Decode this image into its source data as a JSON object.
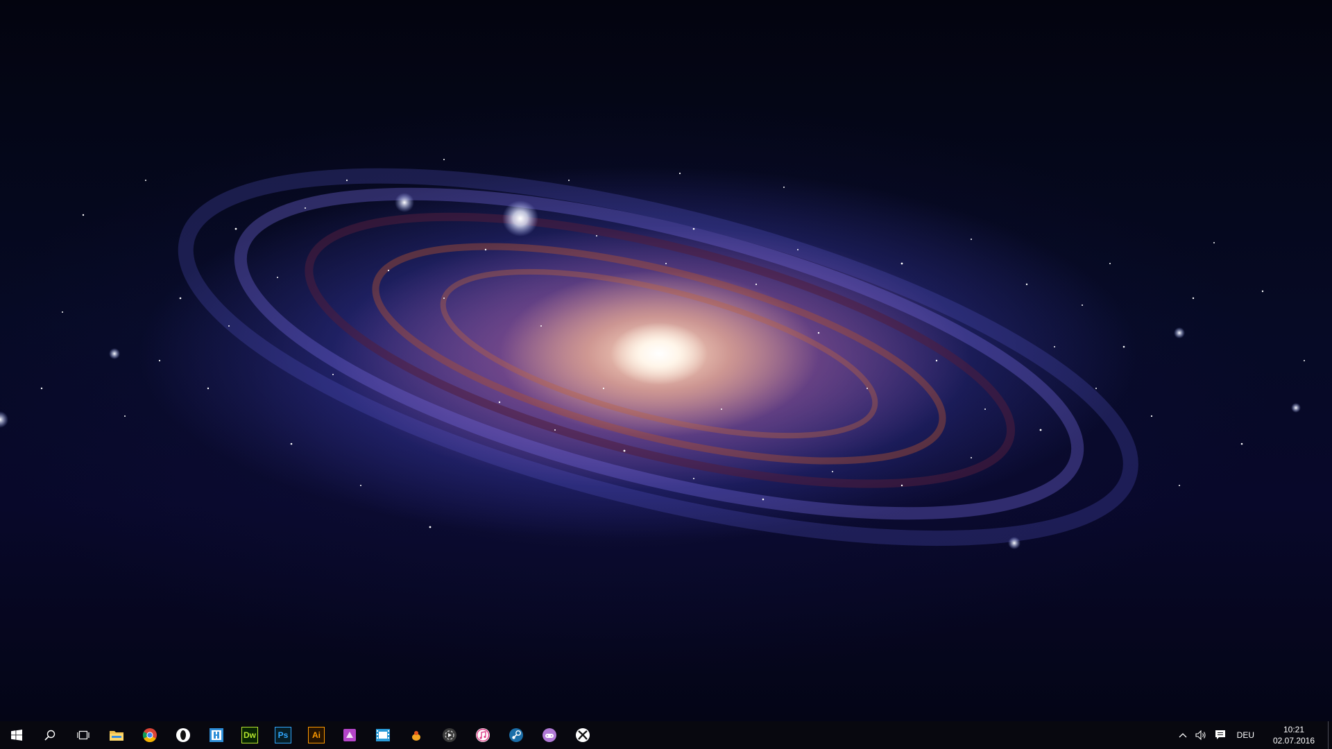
{
  "desktop": {
    "wallpaper": "spiral-galaxy"
  },
  "taskbar": {
    "start_icon": "windows-logo-icon",
    "search_icon": "search-icon",
    "task_view_icon": "task-view-icon",
    "pinned_apps": [
      {
        "name": "file-explorer",
        "icon": "folder-icon",
        "color": "#f2c14e"
      },
      {
        "name": "chrome",
        "icon": "chrome-icon",
        "color": "#db4437"
      },
      {
        "name": "opera",
        "icon": "opera-icon",
        "color": "#ffffff"
      },
      {
        "name": "app-blue",
        "icon": "app-blue-icon",
        "color": "#2f8fd8"
      },
      {
        "name": "dreamweaver",
        "label": "Dw",
        "color": "#b7e62e"
      },
      {
        "name": "photoshop",
        "label": "Ps",
        "color": "#31a8ff"
      },
      {
        "name": "illustrator",
        "label": "Ai",
        "color": "#ff9a00"
      },
      {
        "name": "app-purple",
        "icon": "purple-app-icon",
        "color": "#b545c9"
      },
      {
        "name": "movie-maker",
        "icon": "film-icon",
        "color": "#2a9bd8"
      },
      {
        "name": "app-orange",
        "icon": "orange-app-icon",
        "color": "#f5a623"
      },
      {
        "name": "media-player",
        "icon": "media-icon",
        "color": "#cccccc"
      },
      {
        "name": "itunes",
        "icon": "music-icon",
        "color": "#e0408a"
      },
      {
        "name": "steam",
        "icon": "steam-icon",
        "color": "#1b6ea8"
      },
      {
        "name": "app-game",
        "icon": "game-icon",
        "color": "#b17ad6"
      },
      {
        "name": "xbox",
        "icon": "xbox-icon",
        "color": "#ffffff"
      }
    ],
    "tray": {
      "chevron_icon": "chevron-up-icon",
      "volume_icon": "volume-icon",
      "notification_icon": "action-center-icon",
      "language": "DEU",
      "time": "10:21",
      "date": "02.07.2016"
    }
  }
}
